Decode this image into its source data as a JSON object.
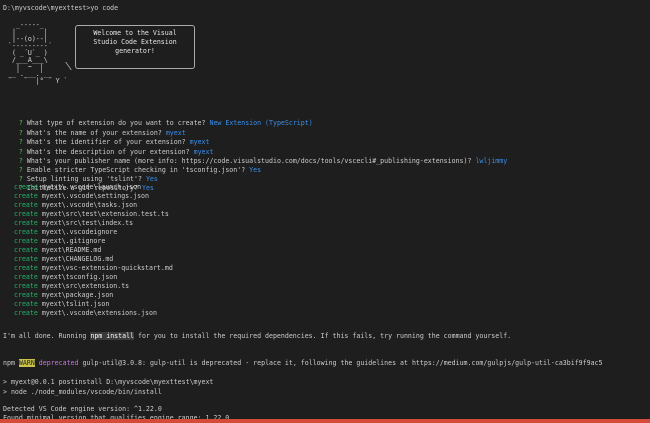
{
  "terminal": {
    "command_line": "D:\\myvscode\\myexttest>yo code",
    "ascii_art": "  _-----_\n |       |\n |--(o)--|\n`---------´\n ( _´U`_ )\n /___A___\\\n  |  ~  |\n__'.___.'__\n´   `  |° ´ Y `",
    "welcome": "Welcome to the Visual\nStudio Code Extension\ngenerator!",
    "prompts": [
      {
        "q": "What type of extension do you want to create?",
        "a": "New Extension (TypeScript)"
      },
      {
        "q": "What's the name of your extension?",
        "a": "myext"
      },
      {
        "q": "What's the identifier of your extension?",
        "a": "myext"
      },
      {
        "q": "What's the description of your extension?",
        "a": "myext"
      },
      {
        "q": "What's your publisher name (more info: https://code.visualstudio.com/docs/tools/vscecli#_publishing-extensions)?",
        "a": "lwljimmy"
      },
      {
        "q": "Enable stricter TypeScript checking in 'tsconfig.json'?",
        "a": "Yes"
      },
      {
        "q": "Setup linting using 'tslint'?",
        "a": "Yes"
      },
      {
        "q": "Initialize a git repository?",
        "a": "Yes"
      }
    ],
    "create_label": "create",
    "created_files": [
      "myext\\.vscode\\launch.json",
      "myext\\.vscode\\settings.json",
      "myext\\.vscode\\tasks.json",
      "myext\\src\\test\\extension.test.ts",
      "myext\\src\\test\\index.ts",
      "myext\\.vscodeignore",
      "myext\\.gitignore",
      "myext\\README.md",
      "myext\\CHANGELOG.md",
      "myext\\vsc-extension-quickstart.md",
      "myext\\tsconfig.json",
      "myext\\src\\extension.ts",
      "myext\\package.json",
      "myext\\tslint.json",
      "myext\\.vscode\\extensions.json"
    ],
    "done_pre": "I'm all done. Running ",
    "done_cmd": "npm install",
    "done_post": " for you to install the required dependencies. If this fails, try running the command yourself.",
    "npm_label": "npm",
    "warn_label": "WARN",
    "deprecated_label": "deprecated",
    "warn_msg": " gulp-util@3.0.8: gulp-util is deprecated - replace it, following the guidelines at https://medium.com/gulpjs/gulp-util-ca3bif9f9ac5",
    "postinstall": "> myext@0.0.1 postinstall D:\\myvscode\\myexttest\\myext",
    "node_cmd": "> node ./node_modules/vscode/bin/install",
    "engine_detected": "Detected VS Code engine version: ^1.22.0",
    "engine_found": "Found minimal version that qualifies engine range: 1.22.0"
  }
}
